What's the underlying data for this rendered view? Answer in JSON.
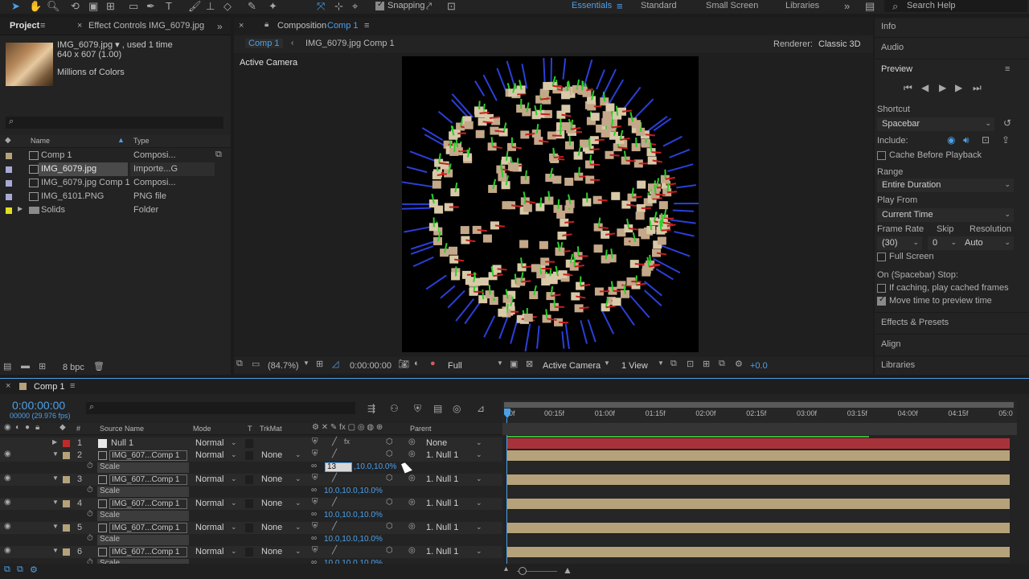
{
  "toolbar": {
    "snapping": "Snapping",
    "workspaces": [
      "Essentials",
      "Standard",
      "Small Screen",
      "Libraries"
    ],
    "search_help": "Search Help"
  },
  "project": {
    "tab_project": "Project",
    "tab_effect_controls": "Effect Controls IMG_6079.jpg",
    "selected_name": "IMG_6079.jpg ▾ , used 1 time",
    "selected_dims": "640 x 607 (1.00)",
    "selected_colors": "Millions of Colors",
    "search_placeholder": "",
    "col_name": "Name",
    "col_type": "Type",
    "items": [
      {
        "name": "Comp 1",
        "type": "Composi...",
        "color": "#b5a27a"
      },
      {
        "name": "IMG_6079.jpg",
        "type": "Importe...G",
        "color": "#a9a9d8"
      },
      {
        "name": "IMG_6079.jpg Comp 1",
        "type": "Composi...",
        "color": "#a9a9d8"
      },
      {
        "name": "IMG_6101.PNG",
        "type": "PNG file",
        "color": "#a9a9d8"
      },
      {
        "name": "Solids",
        "type": "Folder",
        "color": "#e0e020"
      }
    ],
    "bpc": "8 bpc"
  },
  "viewer": {
    "tab_label": "Composition",
    "tab_comp": "Comp 1",
    "breadcrumb_comp": "Comp 1",
    "breadcrumb_nested": "IMG_6079.jpg Comp 1",
    "renderer_label": "Renderer:",
    "renderer_value": "Classic 3D",
    "active_camera": "Active Camera",
    "zoom": "(84.7%)",
    "timecode": "0:00:00:00",
    "resolution": "Full",
    "camera_select": "Active Camera",
    "views": "1 View",
    "exposure": "+0.0"
  },
  "right": {
    "info": "Info",
    "audio": "Audio",
    "preview": "Preview",
    "shortcut_label": "Shortcut",
    "shortcut_value": "Spacebar",
    "include_label": "Include:",
    "cache_before": "Cache Before Playback",
    "range_label": "Range",
    "range_value": "Entire Duration",
    "play_from_label": "Play From",
    "play_from_value": "Current Time",
    "frame_rate_label": "Frame Rate",
    "skip_label": "Skip",
    "resolution_label": "Resolution",
    "frame_rate_value": "(30)",
    "skip_value": "0",
    "resolution_value": "Auto",
    "full_screen": "Full Screen",
    "on_stop": "On (Spacebar) Stop:",
    "if_caching": "If caching, play cached frames",
    "move_time": "Move time to preview time",
    "effects_presets": "Effects & Presets",
    "align": "Align",
    "libraries": "Libraries"
  },
  "timeline": {
    "tab": "Comp 1",
    "timecode": "0:00:00:00",
    "frame_info": "00000 (29.976 fps)",
    "col_source": "Source Name",
    "col_mode": "Mode",
    "col_t": "T",
    "col_trkmat": "TrkMat",
    "col_parent": "Parent",
    "ruler": [
      "0f",
      "00:15f",
      "01:00f",
      "01:15f",
      "02:00f",
      "02:15f",
      "03:00f",
      "03:15f",
      "04:00f",
      "04:15f",
      "05:0"
    ],
    "layers": [
      {
        "num": "1",
        "name": "Null 1",
        "mode": "Normal",
        "trkmat": "",
        "parent": "None",
        "color": "#c02a2a"
      },
      {
        "num": "2",
        "name": "IMG_607...Comp 1",
        "mode": "Normal",
        "trkmat": "None",
        "parent": "1. Null 1",
        "color": "#b5a27a",
        "scale_label": "Scale",
        "scale_edit": "13",
        "scale_rest": ",10.0,10.0%"
      },
      {
        "num": "3",
        "name": "IMG_607...Comp 1",
        "mode": "Normal",
        "trkmat": "None",
        "parent": "1. Null 1",
        "color": "#b5a27a",
        "scale_label": "Scale",
        "scale_value": "10.0,10.0,10.0%"
      },
      {
        "num": "4",
        "name": "IMG_607...Comp 1",
        "mode": "Normal",
        "trkmat": "None",
        "parent": "1. Null 1",
        "color": "#b5a27a",
        "scale_label": "Scale",
        "scale_value": "10.0,10.0,10.0%"
      },
      {
        "num": "5",
        "name": "IMG_607...Comp 1",
        "mode": "Normal",
        "trkmat": "None",
        "parent": "1. Null 1",
        "color": "#b5a27a",
        "scale_label": "Scale",
        "scale_value": "10.0,10.0,10.0%"
      },
      {
        "num": "6",
        "name": "IMG_607...Comp 1",
        "mode": "Normal",
        "trkmat": "None",
        "parent": "1. Null 1",
        "color": "#b5a27a",
        "scale_label": "Scale",
        "scale_value": "10.0,10.0,10.0%"
      }
    ]
  }
}
